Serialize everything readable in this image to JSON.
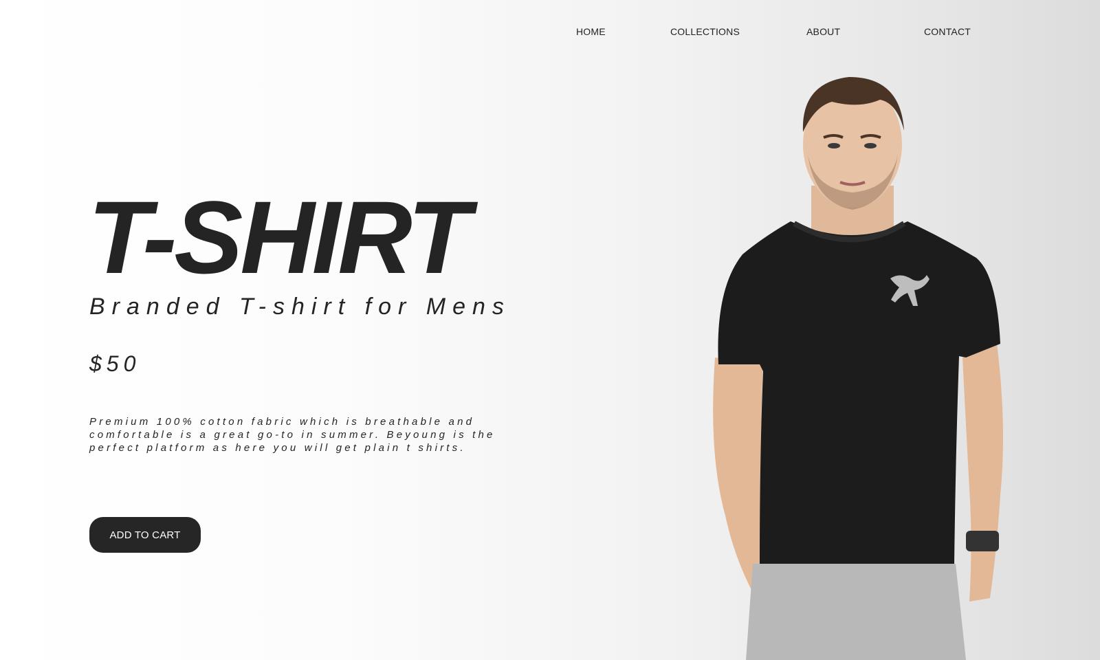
{
  "nav": {
    "items": [
      {
        "label": "HOME"
      },
      {
        "label": "COLLECTIONS"
      },
      {
        "label": "ABOUT"
      },
      {
        "label": "CONTACT"
      }
    ]
  },
  "hero": {
    "title": "T-SHIRT",
    "subtitle": "Branded T-shirt for Mens",
    "price": "$50",
    "description": "Premium 100% cotton fabric which is breathable and comfortable is a great go-to in summer. Beyoung is the perfect platform as here you will get plain t shirts.",
    "cta_label": "ADD TO CART"
  },
  "colors": {
    "text": "#242424",
    "button_bg": "#262626",
    "button_text": "#ffffff",
    "shirt": "#1c1c1c",
    "logo": "#bdbdbd"
  },
  "image": {
    "icon": "model-in-tshirt-photo"
  }
}
